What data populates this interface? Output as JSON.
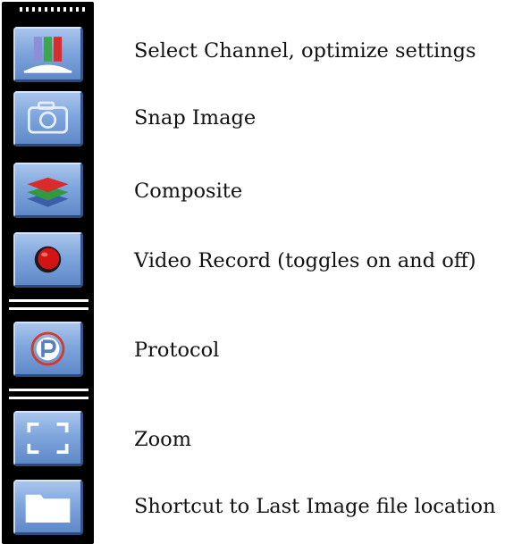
{
  "toolbar": {
    "buttons": [
      {
        "icon": "channel-select-icon",
        "label": "Select Channel, optimize settings"
      },
      {
        "icon": "camera-icon",
        "label": "Snap Image"
      },
      {
        "icon": "layers-icon",
        "label": "Composite"
      },
      {
        "icon": "record-icon",
        "label": "Video Record (toggles on and off)"
      },
      {
        "icon": "protocol-p-icon",
        "label": "Protocol"
      },
      {
        "icon": "zoom-frame-icon",
        "label": "Zoom"
      },
      {
        "icon": "folder-icon",
        "label": "Shortcut to Last Image file location"
      }
    ]
  },
  "colors": {
    "button_face": "#7fa6dc",
    "record_red": "#d21414",
    "protocol_ring": "#d23a2a",
    "toolbar_bg": "#000000"
  }
}
